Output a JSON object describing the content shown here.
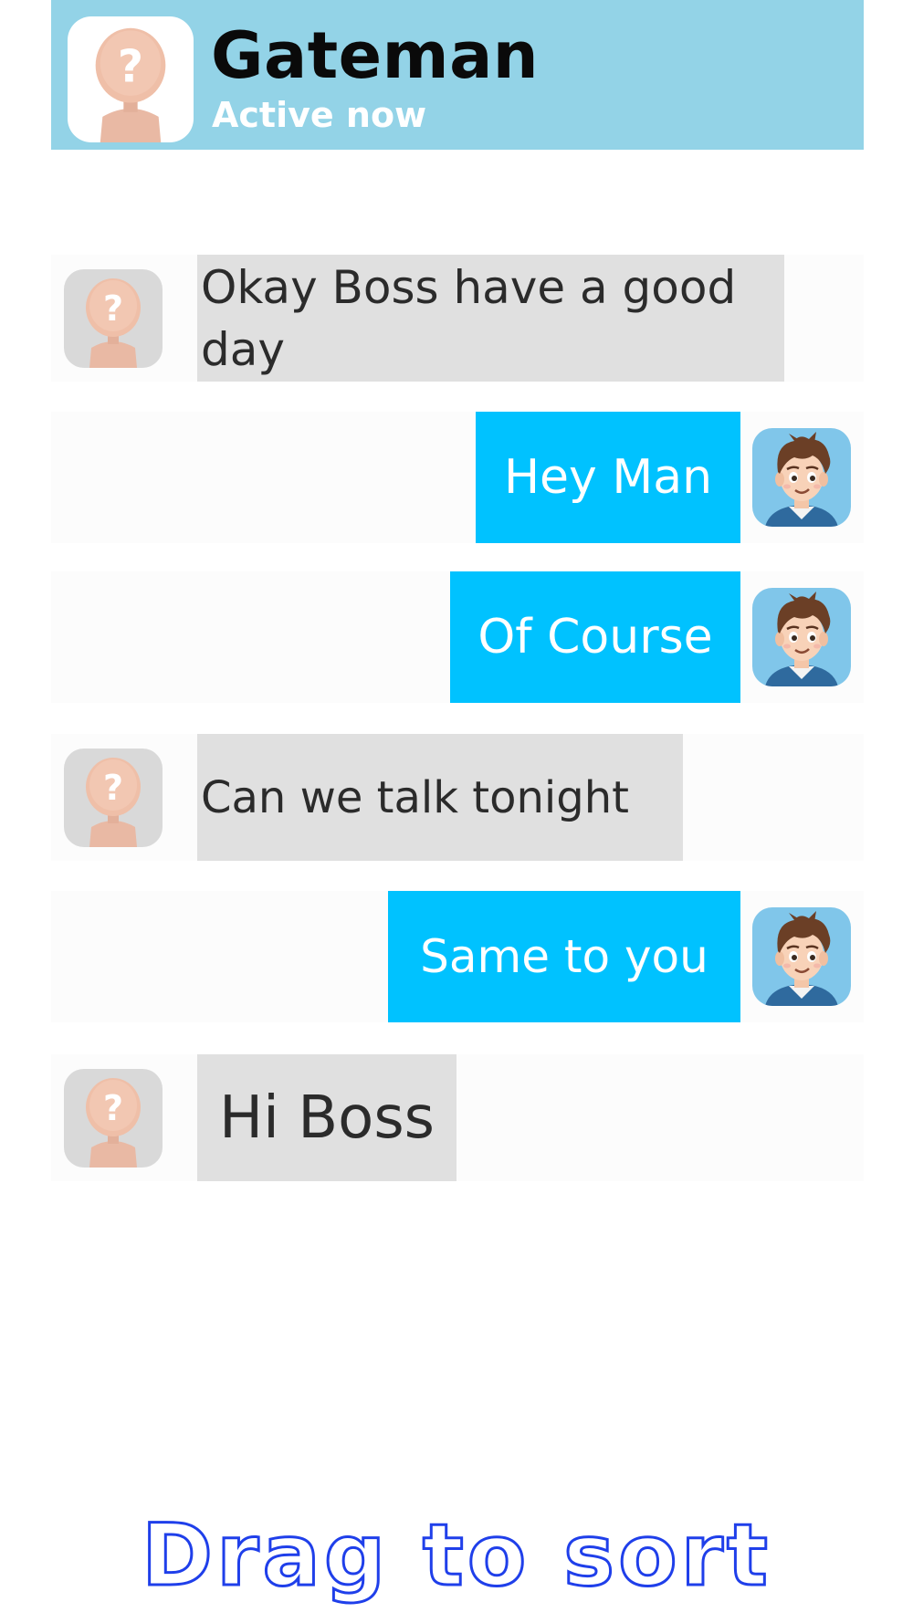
{
  "header": {
    "title": "Gateman",
    "status": "Active now",
    "avatar_icon": "unknown-person-icon",
    "background_color": "#93d3e7"
  },
  "messages": [
    {
      "side": "incoming",
      "text": "Okay Boss have a good day",
      "avatar_icon": "unknown-person-icon"
    },
    {
      "side": "outgoing",
      "text": "Hey Man",
      "avatar_icon": "cartoon-boy-icon"
    },
    {
      "side": "outgoing",
      "text": "Of Course",
      "avatar_icon": "cartoon-boy-icon"
    },
    {
      "side": "incoming",
      "text": "Can we talk tonight",
      "avatar_icon": "unknown-person-icon"
    },
    {
      "side": "outgoing",
      "text": "Same to you",
      "avatar_icon": "cartoon-boy-icon"
    },
    {
      "side": "incoming",
      "text": "Hi Boss",
      "avatar_icon": "unknown-person-icon"
    }
  ],
  "colors": {
    "incoming_bubble": "#e0e0e0",
    "outgoing_bubble": "#00c2ff",
    "footer_outline": "#1f3fea"
  },
  "footer": {
    "instruction": "Drag to sort"
  }
}
